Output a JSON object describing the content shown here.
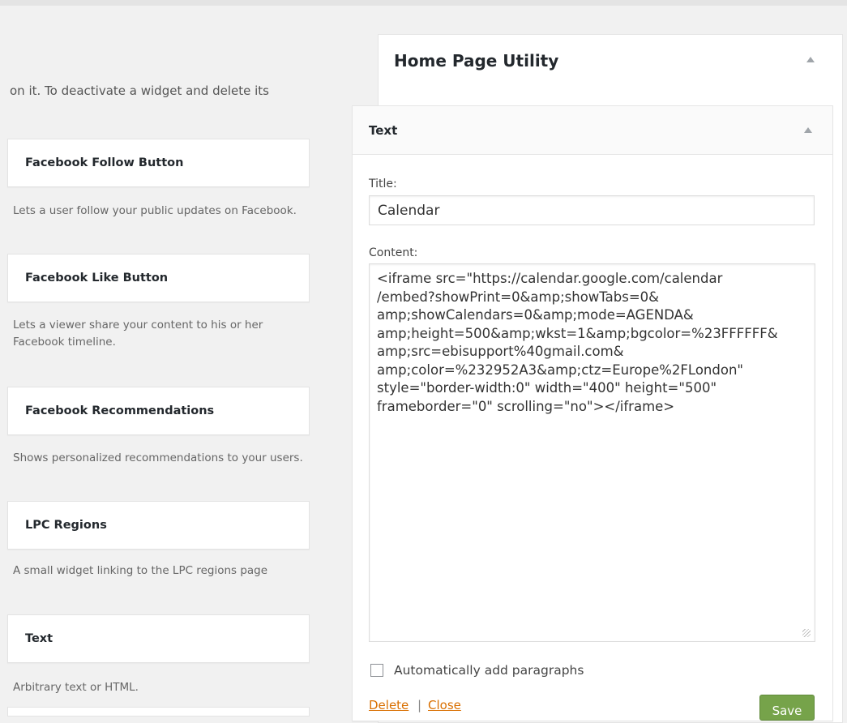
{
  "intro_text": "on it. To deactivate a widget and delete its",
  "available_widgets": [
    {
      "title": "Facebook Follow Button",
      "description": "Lets a user follow your public updates on Facebook."
    },
    {
      "title": "Facebook Like Button",
      "description": "Lets a viewer share your content to his or her Facebook timeline."
    },
    {
      "title": "Facebook Recommendations",
      "description": "Shows personalized recommendations to your users."
    },
    {
      "title": "LPC Regions",
      "description": "A small widget linking to the LPC regions page"
    },
    {
      "title": "Text",
      "description": "Arbitrary text or HTML."
    }
  ],
  "sidebar": {
    "title": "Home Page Utility",
    "toggle_icon": "arrow-up-icon"
  },
  "text_widget": {
    "header": "Text",
    "toggle_icon": "arrow-up-icon",
    "title_label": "Title:",
    "title_value": "Calendar",
    "content_label": "Content:",
    "content_value": "<iframe src=\"https://calendar.google.com/calendar\n/embed?showPrint=0&amp;showTabs=0&\namp;showCalendars=0&amp;mode=AGENDA&\namp;height=500&amp;wkst=1&amp;bgcolor=%23FFFFFF&\namp;src=ebisupport%40gmail.com&\namp;color=%232952A3&amp;ctz=Europe%2FLondon\"\nstyle=\"border-width:0\" width=\"400\" height=\"500\"\nframeborder=\"0\" scrolling=\"no\"></iframe>",
    "auto_paragraphs_label": "Automatically add paragraphs",
    "auto_paragraphs_checked": false,
    "delete_label": "Delete",
    "separator": "|",
    "close_label": "Close",
    "save_label": "Save"
  },
  "colors": {
    "link": "#d96f00",
    "save_button": "#76a34a",
    "background": "#f1f1f1"
  }
}
